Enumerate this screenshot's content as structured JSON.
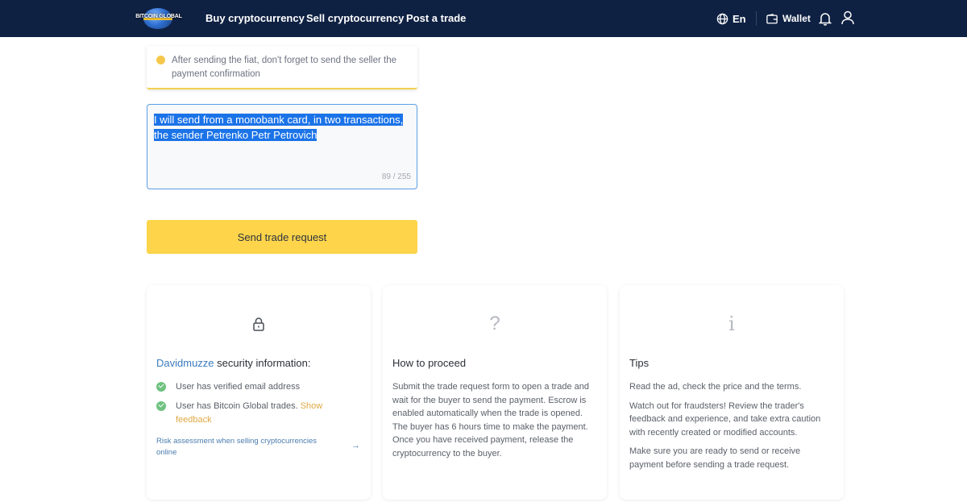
{
  "header": {
    "logo_text": "BITCOIN GLOBAL",
    "nav": [
      "Buy cryptocurrency",
      "Sell cryptocurrency",
      "Post a trade"
    ],
    "language": "En",
    "wallet_label": "Wallet"
  },
  "notice": {
    "text": "After sending the fiat, don't forget to send the seller the payment confirmation"
  },
  "message": {
    "value": "I will send from a monobank card, in two transactions, the sender Petrenko Petr Petrovich",
    "counter": "89 / 255"
  },
  "send_button": "Send trade request",
  "cards": {
    "security": {
      "username": "Davidmuzze",
      "title_suffix": " security information:",
      "check1": "User has verified email address",
      "check2": "User has Bitcoin Global trades. ",
      "show_feedback": "Show feedback",
      "risk_link": "Risk assessment when selling cryptocurrencies online",
      "icon": "lock-icon"
    },
    "proceed": {
      "title": "How to proceed",
      "body": "Submit the trade request form to open a trade and wait for the buyer to send the payment. Escrow is enabled automatically when the trade is opened. The buyer has 6 hours time to make the payment. Once you have received payment, release the cryptocurrency to the buyer.",
      "icon": "question-icon"
    },
    "tips": {
      "title": "Tips",
      "p1": "Read the ad, check the price and the terms.",
      "p2": "Watch out for fraudsters! Review the trader's feedback and experience, and take extra caution with recently created or modified accounts.",
      "p3": "Make sure you are ready to send or receive payment before sending a trade request.",
      "icon": "info-icon"
    }
  },
  "colors": {
    "header_bg": "#0f2143",
    "accent_yellow": "#fdd44a",
    "link_blue": "#3a7bbd",
    "success_green": "#6fc280"
  }
}
